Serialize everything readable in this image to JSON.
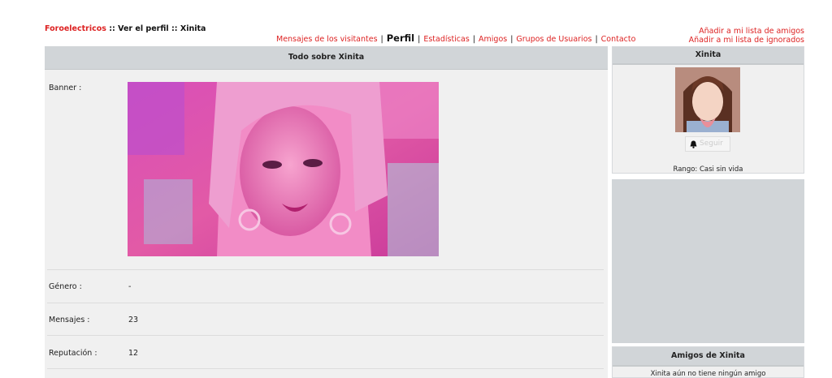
{
  "breadcrumb": {
    "site": "Foroelectricos",
    "sep1": " :: ",
    "page": "Ver el perfil",
    "sep2": " :: ",
    "user": "Xinita"
  },
  "topnav": {
    "visitor_messages": "Mensajes de los visitantes",
    "profile": "Perfil",
    "statistics": "Estadísticas",
    "friends": "Amigos",
    "user_groups": "Grupos de Usuarios",
    "contact": "Contacto",
    "separator": "|"
  },
  "right_links": {
    "add_friend": "Añadir a mi lista de amigos",
    "add_ignored": "Añadir a mi lista de ignorados"
  },
  "main": {
    "title": "Todo sobre Xinita",
    "fields": [
      {
        "label": "Banner :",
        "value": ""
      },
      {
        "label": "Género :",
        "value": "-"
      },
      {
        "label": "Mensajes :",
        "value": "23"
      },
      {
        "label": "Reputación :",
        "value": "12"
      }
    ]
  },
  "sidebar": {
    "profile_title": "Xinita",
    "follow_label": "Seguir",
    "rank": "Rango: Casi sin vida",
    "friends_title": "Amigos de Xinita",
    "friends_note": "Xinita aún no tiene ningún amigo"
  },
  "colors": {
    "accent": "#dd2222",
    "header_bg": "#d1d5d8",
    "panel_bg": "#f0f0f0",
    "banner_tint": "#e040a8"
  },
  "icons": {
    "follow": "bell-icon"
  }
}
